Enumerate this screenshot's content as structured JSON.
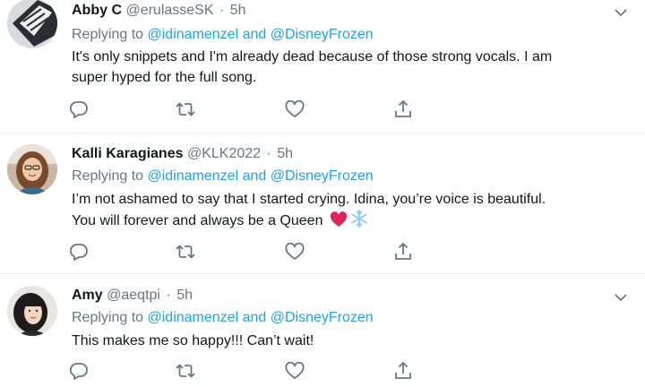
{
  "replying_prefix": "Replying to ",
  "tweets": [
    {
      "name": "Abby C",
      "handle": "@erulasseSK",
      "dot": "·",
      "time": "5h",
      "mentions": "@idinamenzel and @DisneyFrozen",
      "text_lines": [
        "It's only snippets and I'm already dead because of those strong vocals. I am",
        "super hyped for the full song."
      ]
    },
    {
      "name": "Kalli Karagianes",
      "handle": "@KLK2022",
      "dot": "·",
      "time": "5h",
      "mentions": "@idinamenzel and @DisneyFrozen",
      "text_lines": [
        "I’m not ashamed to say that I started crying. Idina, you’re voice is beautiful.",
        "You will forever and always be a Queen"
      ],
      "emojis": [
        "red-heart-emoji",
        "snowflake-emoji"
      ]
    },
    {
      "name": "Amy",
      "handle": "@aeqtpi",
      "dot": "·",
      "time": "5h",
      "mentions": "@idinamenzel and @DisneyFrozen",
      "text_lines": [
        "This makes me so happy!!! Can’t wait!"
      ]
    }
  ],
  "icons": {
    "reply": "reply-icon",
    "retweet": "retweet-icon",
    "like": "like-icon",
    "share": "share-icon",
    "more": "chevron-down-icon"
  },
  "colors": {
    "name": "#14171a",
    "secondary": "#657786",
    "link": "#1da1f2",
    "divider": "#e6ecf0",
    "heart": "#e0245e",
    "snowflake": "#88c9f9"
  }
}
